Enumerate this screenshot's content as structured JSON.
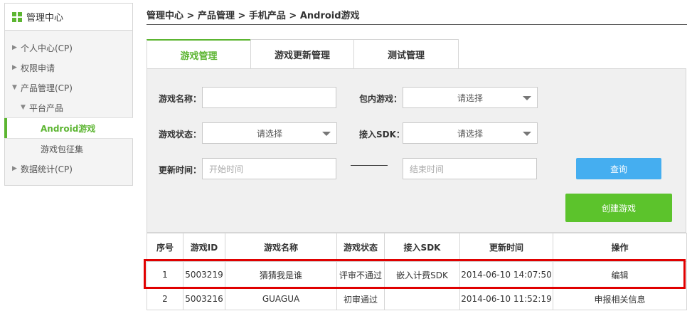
{
  "sidebar": {
    "title": "管理中心",
    "items": [
      {
        "label": "个人中心(CP)",
        "arrow": "▶"
      },
      {
        "label": "权限申请",
        "arrow": "▶"
      },
      {
        "label": "产品管理(CP)",
        "arrow": "▼"
      },
      {
        "label": "平台产品",
        "arrow": "▼"
      },
      {
        "label": "Android游戏"
      },
      {
        "label": "游戏包征集"
      },
      {
        "label": "数据统计(CP)",
        "arrow": "▶"
      }
    ]
  },
  "breadcrumb": "管理中心 > 产品管理 > 手机产品 > Android游戏",
  "tabs": [
    "游戏管理",
    "游戏更新管理",
    "测试管理"
  ],
  "filters": {
    "game_name_label": "游戏名称：",
    "in_package_label": "包内游戏：",
    "status_label": "游戏状态：",
    "sdk_label": "接入SDK：",
    "update_time_label": "更新时间：",
    "select_placeholder": "请选择",
    "start_placeholder": "开始时间",
    "end_placeholder": "结束时间",
    "query_button": "查询",
    "create_button": "创建游戏"
  },
  "table": {
    "headers": [
      "序号",
      "游戏ID",
      "游戏名称",
      "游戏状态",
      "接入SDK",
      "更新时间",
      "操作"
    ],
    "rows": [
      {
        "index": "1",
        "id": "5003219",
        "name": "猜猜我是谁",
        "status": "评审不通过",
        "sdk": "嵌入计费SDK",
        "updated": "2014-06-10 14:07:50",
        "action": "编辑"
      },
      {
        "index": "2",
        "id": "5003216",
        "name": "GUAGUA",
        "status": "初审通过",
        "sdk": "",
        "updated": "2014-06-10 11:52:19",
        "action": "申报相关信息"
      }
    ]
  },
  "colors": {
    "accent_green": "#5cb531",
    "link_blue": "#1c78c0",
    "query_blue": "#45aef0",
    "highlight_red": "#e00000"
  }
}
